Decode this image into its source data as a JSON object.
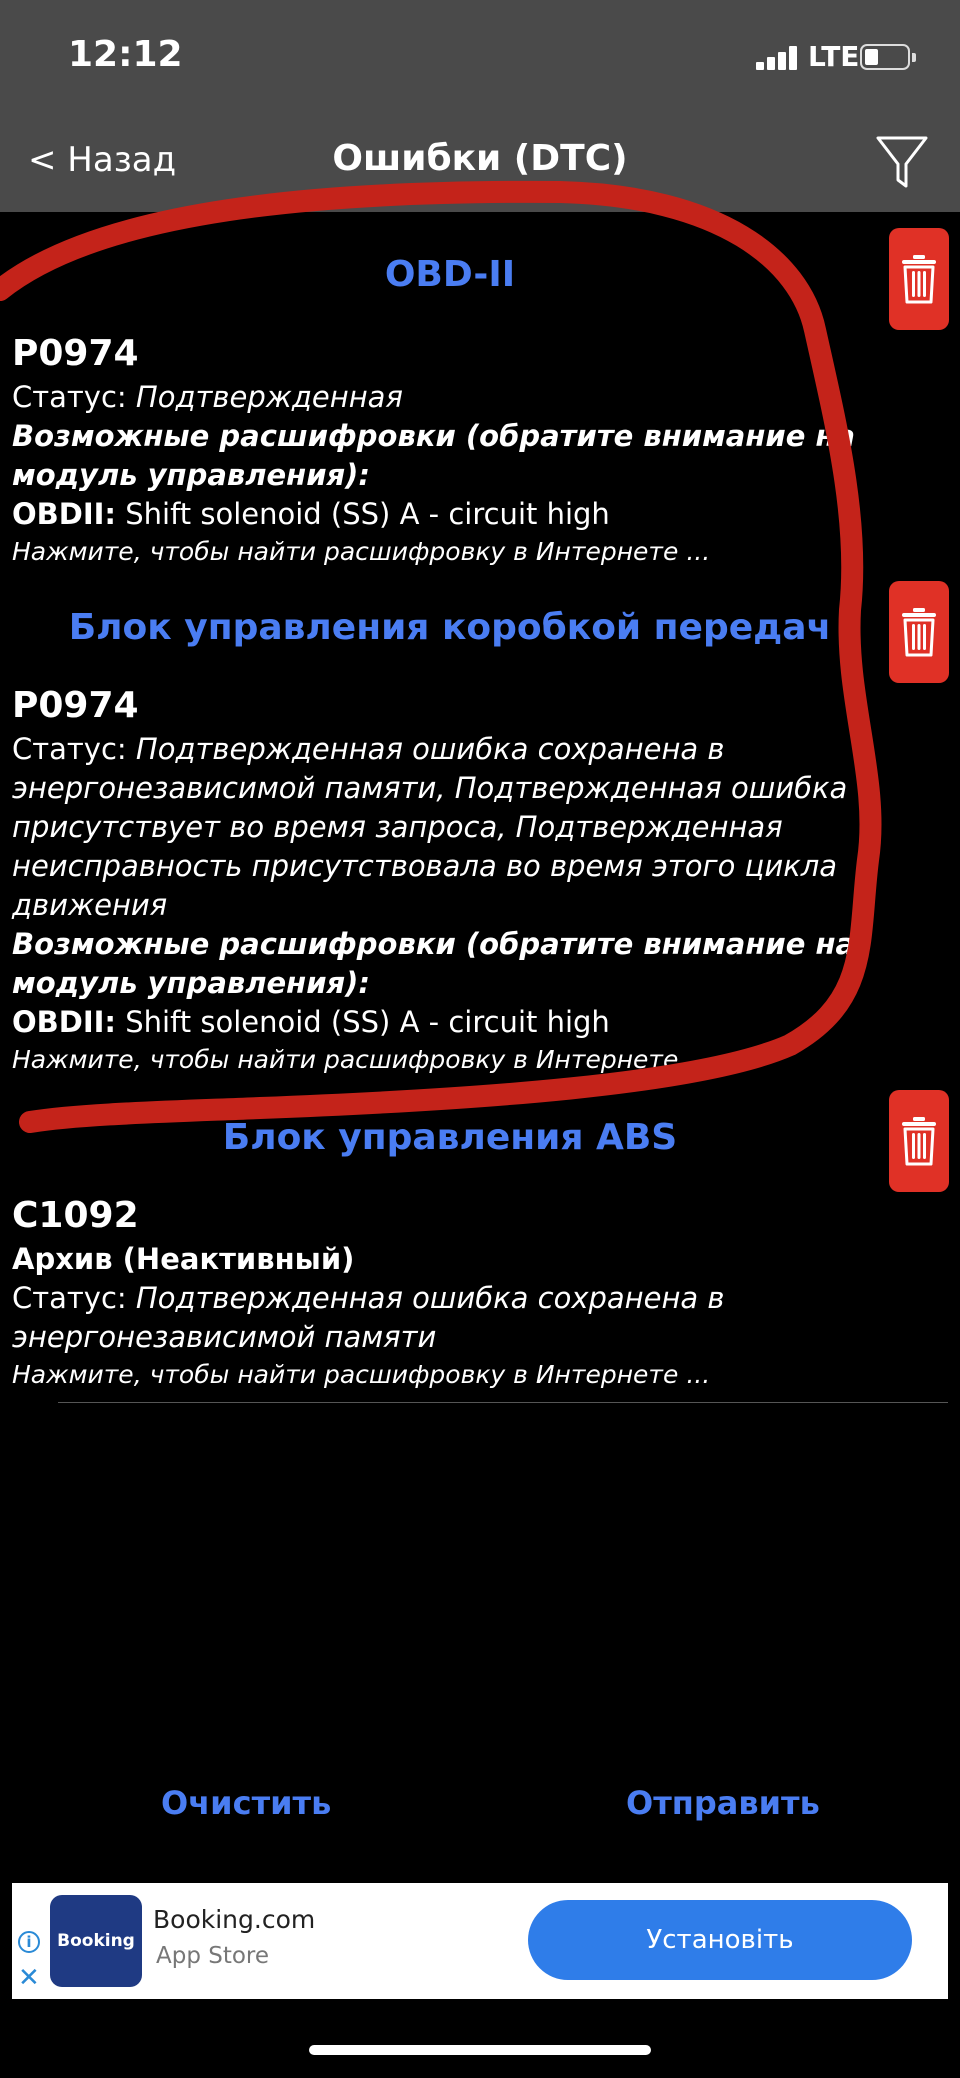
{
  "status_bar": {
    "time": "12:12",
    "network": "LTE"
  },
  "nav": {
    "back_label": "< Назад",
    "title": "Ошибки (DTC)"
  },
  "sections": [
    {
      "header": "OBD-II",
      "entries": [
        {
          "code": "P0974",
          "status_label": "Статус:",
          "status_value": "Подтвержденная",
          "decode_title": "Возможные расшифровки (обратите внимание на модуль управления):",
          "decode_label": "OBDII:",
          "decode_value": "Shift solenoid (SS) A - circuit high",
          "hint": "Нажмите, чтобы найти расшифровку в Интернете ..."
        }
      ]
    },
    {
      "header": "Блок управления коробкой передач",
      "entries": [
        {
          "code": "P0974",
          "status_label": "Статус:",
          "status_value": "Подтвержденная ошибка сохранена в энергонезависимой памяти, Подтвержденная ошибка присутствует во время запроса, Подтвержденная неисправность присутствовала во время этого цикла движения",
          "decode_title": "Возможные расшифровки (обратите внимание на модуль управления):",
          "decode_label": "OBDII:",
          "decode_value": "Shift solenoid (SS) A - circuit high",
          "hint": "Нажмите, чтобы найти расшифровку в Интернете ..."
        }
      ]
    },
    {
      "header": "Блок управления ABS",
      "entries": [
        {
          "code": "C1092",
          "archive": "Архив (Неактивный)",
          "status_label": "Статус:",
          "status_value": "Подтвержденная ошибка сохранена в энергонезависимой памяти",
          "hint": "Нажмите, чтобы найти расшифровку в Интернете ..."
        }
      ]
    }
  ],
  "actions": {
    "clear_label": "Очистить",
    "send_label": "Отправить"
  },
  "ad": {
    "logo_text": "Booking",
    "title": "Booking.com",
    "subtitle": "App Store",
    "button_label": "Установіть"
  },
  "icons": {
    "back": "back-chevron",
    "filter": "funnel-icon",
    "delete": "trash-icon",
    "ad_info": "info-icon",
    "ad_close": "close-icon"
  },
  "colors": {
    "header_blue": "#4a7df2",
    "trash_red": "#e03126",
    "bar_gray": "#4a4a4a",
    "ad_button": "#2f7de9",
    "annotation_red": "#c4231a"
  }
}
